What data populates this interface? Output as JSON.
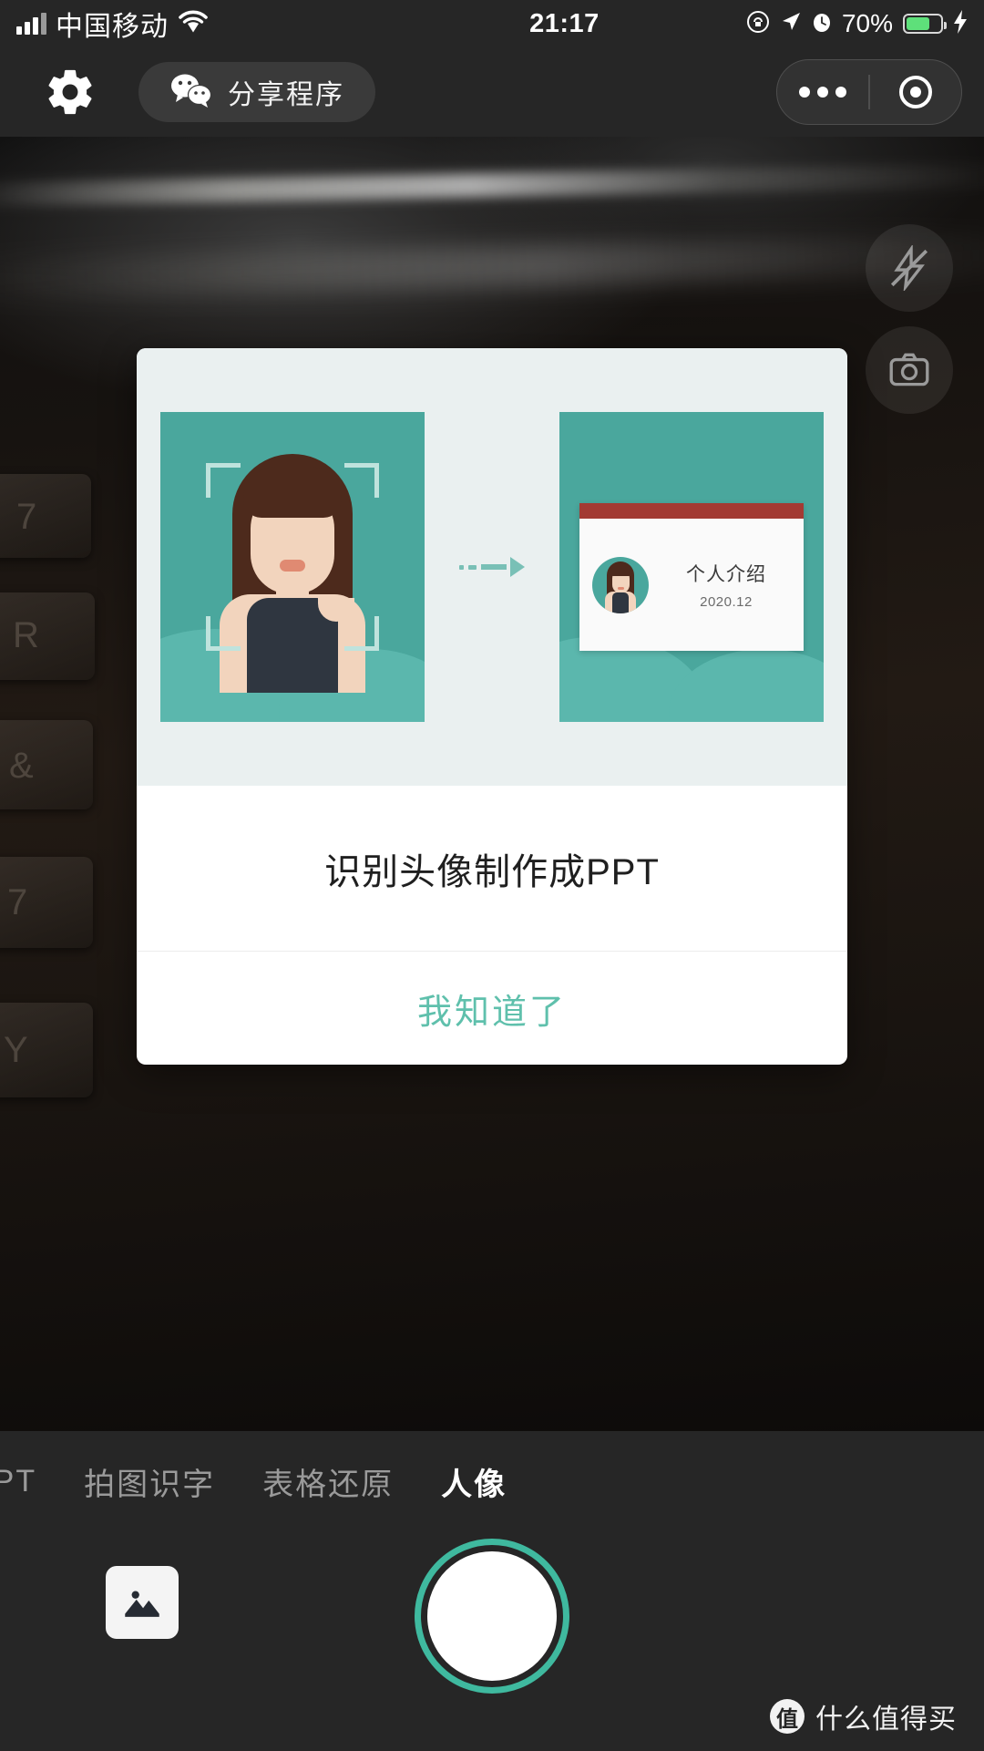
{
  "colors": {
    "accent_teal": "#4aa79d",
    "button_teal": "#5fc0ac",
    "shutter_ring": "#3fb99f",
    "bar_dark": "#262626",
    "slide_red": "#a33a33",
    "card_illus_bg": "#eaf0f0"
  },
  "status_bar": {
    "carrier": "中国移动",
    "time": "21:17",
    "battery_percent": "70%",
    "icons": {
      "signal": "signal-bars-icon",
      "wifi": "wifi-icon",
      "rotation_lock": "rotation-lock-icon",
      "location": "location-arrow-icon",
      "alarm": "alarm-clock-icon",
      "battery": "battery-icon",
      "charging": "lightning-bolt-icon"
    }
  },
  "nav_bar": {
    "settings_icon": "gear-icon",
    "share_label": "分享程序",
    "share_icon": "wechat-icon",
    "capsule": {
      "more_icon": "more-dots-icon",
      "close_icon": "target-circle-icon"
    }
  },
  "camera": {
    "flash_icon": "flash-off-icon",
    "flip_icon": "camera-flip-icon"
  },
  "modal": {
    "title": "识别头像制作成PPT",
    "action_label": "我知道了",
    "illustration": {
      "left_panel_name": "portrait-photo-panel",
      "right_panel_name": "ppt-result-panel",
      "arrow_icon": "arrow-right-icon",
      "slide_title": "个人介绍",
      "slide_date": "2020.12"
    }
  },
  "bottom": {
    "tabs": [
      {
        "label": "PPT",
        "active": false
      },
      {
        "label": "拍图识字",
        "active": false
      },
      {
        "label": "表格还原",
        "active": false
      },
      {
        "label": "人像",
        "active": true
      }
    ],
    "gallery_icon": "image-gallery-icon",
    "shutter_name": "shutter-button"
  },
  "watermark": {
    "logo_char": "值",
    "text": "什么值得买"
  }
}
